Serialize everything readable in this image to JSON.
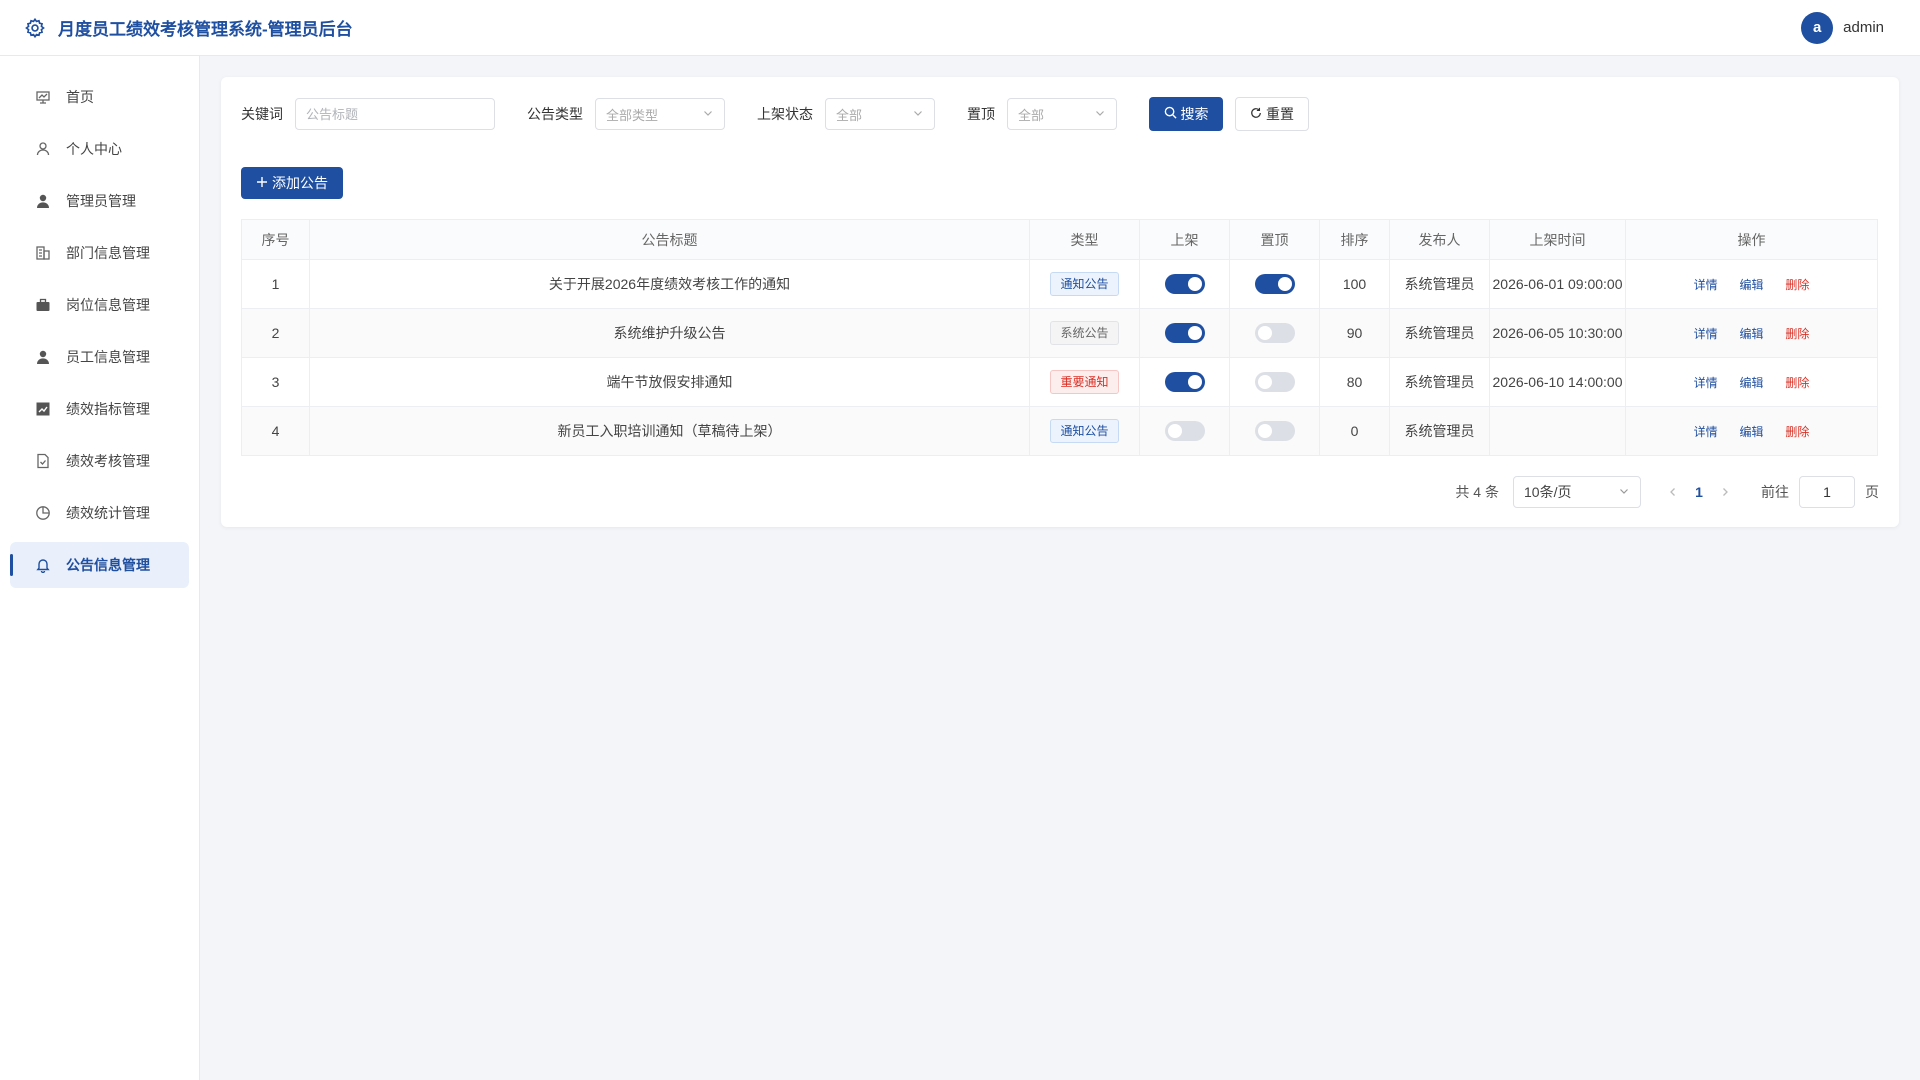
{
  "app": {
    "title": "月度员工绩效考核管理系统-管理员后台"
  },
  "user": {
    "avatar_letter": "a",
    "name": "admin"
  },
  "sidebar": {
    "items": [
      {
        "label": "首页",
        "icon": "home-icon",
        "active": false
      },
      {
        "label": "个人中心",
        "icon": "user-outline-icon",
        "active": false
      },
      {
        "label": "管理员管理",
        "icon": "user-solid-icon",
        "active": false
      },
      {
        "label": "部门信息管理",
        "icon": "building-icon",
        "active": false
      },
      {
        "label": "岗位信息管理",
        "icon": "briefcase-icon",
        "active": false
      },
      {
        "label": "员工信息管理",
        "icon": "user-solid-icon",
        "active": false
      },
      {
        "label": "绩效指标管理",
        "icon": "chart-icon",
        "active": false
      },
      {
        "label": "绩效考核管理",
        "icon": "document-check-icon",
        "active": false
      },
      {
        "label": "绩效统计管理",
        "icon": "pie-icon",
        "active": false
      },
      {
        "label": "公告信息管理",
        "icon": "bell-icon",
        "active": true
      }
    ]
  },
  "filters": {
    "keyword_label": "关键词",
    "keyword_placeholder": "公告标题",
    "type_label": "公告类型",
    "type_value": "全部类型",
    "status_label": "上架状态",
    "status_value": "全部",
    "top_label": "置顶",
    "top_value": "全部",
    "search_label": "搜索",
    "reset_label": "重置"
  },
  "actions": {
    "add_label": "添加公告"
  },
  "table": {
    "headers": [
      "序号",
      "公告标题",
      "类型",
      "上架",
      "置顶",
      "排序",
      "发布人",
      "上架时间",
      "操作"
    ],
    "rows": [
      {
        "no": "1",
        "title": "关于开展2026年度绩效考核工作的通知",
        "type": "通知公告",
        "type_style": "notice",
        "published": true,
        "pinned": true,
        "order": "100",
        "publisher": "系统管理员",
        "time": "2026-06-01 09:00:00"
      },
      {
        "no": "2",
        "title": "系统维护升级公告",
        "type": "系统公告",
        "type_style": "system",
        "published": true,
        "pinned": false,
        "order": "90",
        "publisher": "系统管理员",
        "time": "2026-06-05 10:30:00"
      },
      {
        "no": "3",
        "title": "端午节放假安排通知",
        "type": "重要通知",
        "type_style": "important",
        "published": true,
        "pinned": false,
        "order": "80",
        "publisher": "系统管理员",
        "time": "2026-06-10 14:00:00"
      },
      {
        "no": "4",
        "title": "新员工入职培训通知（草稿待上架）",
        "type": "通知公告",
        "type_style": "notice",
        "published": false,
        "pinned": false,
        "order": "0",
        "publisher": "系统管理员",
        "time": ""
      }
    ],
    "op_detail": "详情",
    "op_edit": "编辑",
    "op_delete": "删除"
  },
  "pagination": {
    "total": "共 4 条",
    "page_size": "10条/页",
    "current_page": "1",
    "goto_label": "前往",
    "goto_value": "1",
    "page_suffix": "页"
  },
  "colors": {
    "primary": "#1f4fa0",
    "danger": "#d93025",
    "background": "#f3f5f9"
  }
}
